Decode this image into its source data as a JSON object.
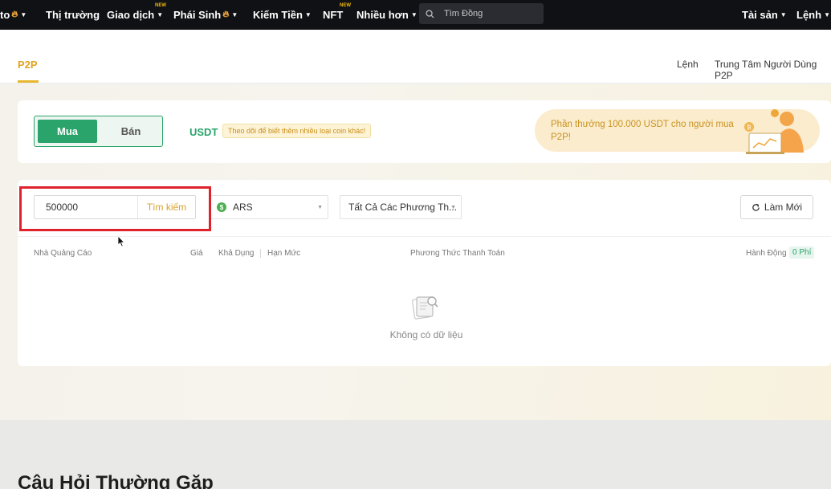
{
  "topnav": {
    "partial_item": "to",
    "items": [
      {
        "label": "Thị trường"
      },
      {
        "label": "Giao dịch",
        "badge": "NEW"
      },
      {
        "label": "Phái Sinh"
      },
      {
        "label": "Kiếm Tiền"
      },
      {
        "label": "NFT",
        "badge": "NEW"
      },
      {
        "label": "Nhiều hơn"
      }
    ],
    "search_placeholder": "Tìm Đồng",
    "assets": "Tài sản",
    "orders": "Lệnh"
  },
  "subheader": {
    "tab": "P2P",
    "links": [
      "Lệnh",
      "Trung Tâm Người Dùng P2P"
    ]
  },
  "trade_card": {
    "buy": "Mua",
    "sell": "Bán",
    "coin": "USDT",
    "coin_hint": "Theo dõi để biết thêm nhiều loại coin khác!",
    "promo": "Phần thưởng 100.000 USDT cho người mua P2P!"
  },
  "filters": {
    "amount_value": "500000",
    "search_button": "Tìm kiếm",
    "fiat": "ARS",
    "payment_method": "Tất Cả Các Phương Th...",
    "refresh": "Làm Mới"
  },
  "table": {
    "headers": {
      "advertiser": "Nhà Quảng Cáo",
      "price": "Giá",
      "available": "Khả Dụng",
      "limit": "Hạn Mức",
      "payment": "Phương Thức Thanh Toán",
      "action": "Hành Động"
    },
    "fee_badge": "0 Phí",
    "empty_text": "Không có dữ liệu"
  },
  "faq": {
    "title": "Câu Hỏi Thường Gặp"
  },
  "colors": {
    "brand_green": "#2aa46b",
    "brand_gold": "#e0a520",
    "highlight_red": "#e0222c",
    "nav_bg": "#101114"
  }
}
